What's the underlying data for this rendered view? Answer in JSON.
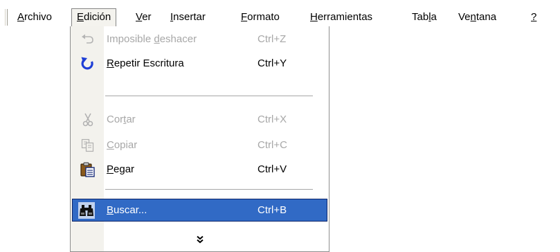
{
  "menubar": {
    "items": [
      {
        "pre": "",
        "acc": "A",
        "post": "rchivo"
      },
      {
        "pre": "",
        "acc": "E",
        "post": "dición"
      },
      {
        "pre": "",
        "acc": "V",
        "post": "er"
      },
      {
        "pre": "",
        "acc": "I",
        "post": "nsertar"
      },
      {
        "pre": "",
        "acc": "F",
        "post": "ormato"
      },
      {
        "pre": "",
        "acc": "H",
        "post": "erramientas"
      },
      {
        "pre": "Tab",
        "acc": "l",
        "post": "a"
      },
      {
        "pre": "Ve",
        "acc": "n",
        "post": "tana"
      },
      {
        "pre": "",
        "acc": "?",
        "post": ""
      }
    ]
  },
  "edit_menu": {
    "undo": {
      "pre": "Imposible ",
      "acc": "d",
      "post": "eshacer",
      "shortcut": "Ctrl+Z",
      "icon": "undo-icon"
    },
    "redo": {
      "pre": "",
      "acc": "R",
      "post": "epetir Escritura",
      "shortcut": "Ctrl+Y",
      "icon": "redo-icon"
    },
    "cut": {
      "pre": "Cor",
      "acc": "t",
      "post": "ar",
      "shortcut": "Ctrl+X",
      "icon": "scissors-icon"
    },
    "copy": {
      "pre": "",
      "acc": "C",
      "post": "opiar",
      "shortcut": "Ctrl+C",
      "icon": "copy-icon"
    },
    "paste": {
      "pre": "",
      "acc": "P",
      "post": "egar",
      "shortcut": "Ctrl+V",
      "icon": "clipboard-icon"
    },
    "find": {
      "pre": "",
      "acc": "B",
      "post": "uscar...",
      "shortcut": "Ctrl+B",
      "icon": "binoculars-icon"
    },
    "expand": {
      "label": "»",
      "icon": "double-chevron-down-icon"
    }
  },
  "colors": {
    "highlight": "#316ac5",
    "gutter": "#f3f2ed",
    "disabled_text": "#a7a7a7"
  }
}
